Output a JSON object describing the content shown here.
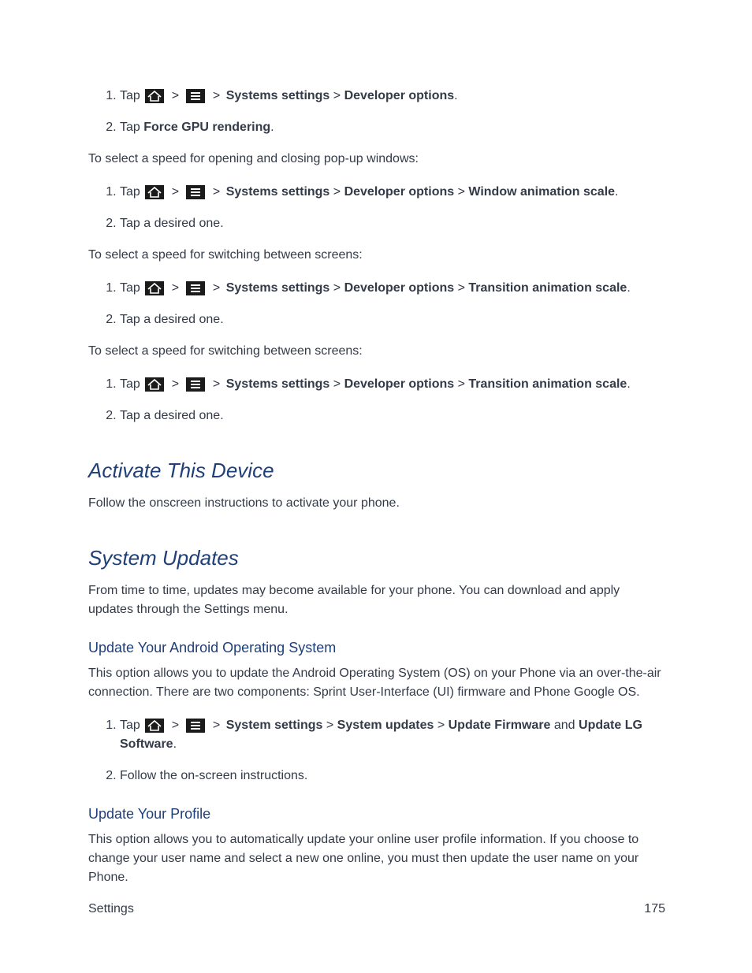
{
  "common": {
    "tap": "Tap ",
    "sep": " > ",
    "period": "."
  },
  "labels": {
    "systems_settings": "Systems settings",
    "system_settings": "System settings",
    "developer_options": "Developer options",
    "window_anim": "Window animation scale",
    "transition_anim": "Transition animation scale",
    "force_gpu": "Force GPU rendering",
    "system_updates": "System updates",
    "update_firmware": "Update Firmware",
    "update_lg_software": "Update LG Software",
    "and": " and "
  },
  "paras": {
    "p1": "To select a speed for opening and closing pop-up windows:",
    "p2": "To select a speed for switching between screens:",
    "p3": "To select a speed for switching between screens:",
    "tap_desired": "Tap a desired one.",
    "follow_onscreen": "Follow the on-screen instructions.",
    "activate_body": "Follow the onscreen instructions to activate your phone.",
    "sysupdates_body": "From time to time, updates may become available for your phone. You can download and apply updates through the Settings menu.",
    "update_os_body": "This option allows you to update the Android Operating System (OS) on your Phone via an over-the-air connection. There are two components: Sprint User-Interface (UI) firmware and Phone Google OS.",
    "update_profile_body": "This option allows you to automatically update your online user profile information. If you choose to change your user name and select a new one online, you must then update the user name on your Phone."
  },
  "headings": {
    "activate": "Activate This Device",
    "system_updates": "System Updates",
    "update_os": "Update Your Android Operating System",
    "update_profile": "Update Your Profile"
  },
  "footer": {
    "left": "Settings",
    "right": "175"
  }
}
